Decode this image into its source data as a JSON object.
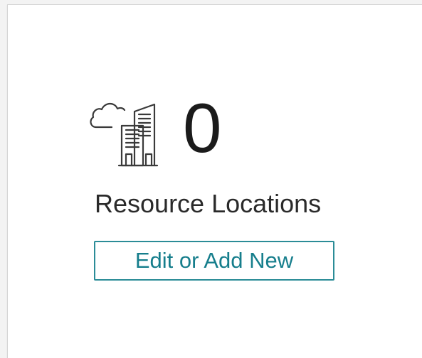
{
  "widget": {
    "icon": "cloud-buildings-icon",
    "count": "0",
    "label": "Resource Locations",
    "button_label": "Edit or Add New"
  },
  "colors": {
    "accent": "#2b8c97",
    "text": "#1b1b1b",
    "icon_stroke": "#3a3a3a"
  }
}
